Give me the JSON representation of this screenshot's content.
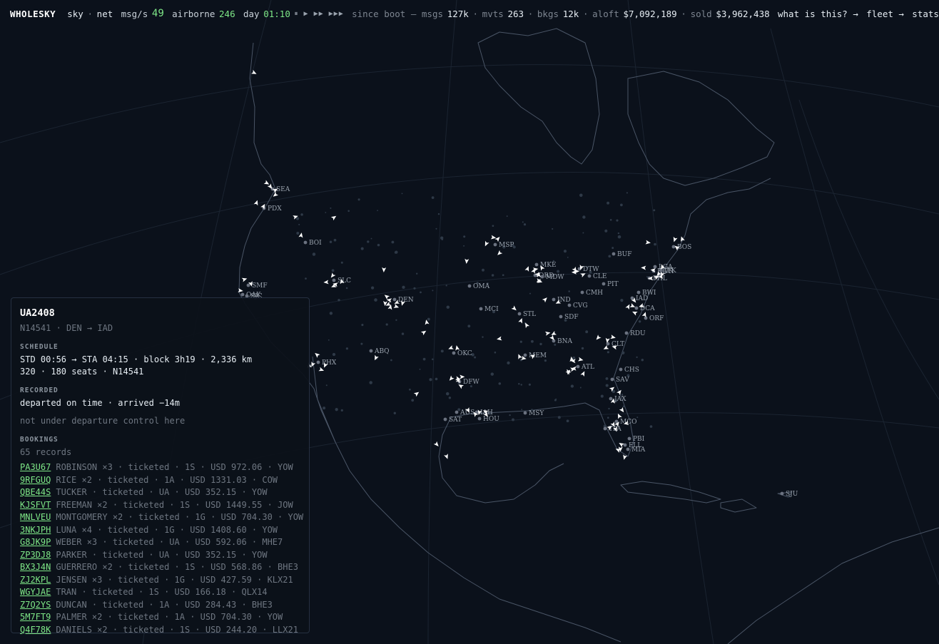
{
  "topbar": {
    "brand": "WHOLESKY",
    "nav_sky": "sky",
    "sep": "·",
    "nav_net": "net",
    "msgs_label": "msg/s",
    "msgs_value": "49",
    "airborne_label": "airborne",
    "airborne_value": "246",
    "day_label": "day",
    "day_value": "01:10",
    "playback_controls": "⏸ ▶ ▶▶ ▶▶▶",
    "since_boot_label": "since boot — msgs",
    "msgs_total": "127k",
    "mvts_label": "mvts",
    "mvts_value": "263",
    "bkgs_label": "bkgs",
    "bkgs_value": "12k",
    "aloft_label": "aloft",
    "aloft_value": "$7,092,189",
    "sold_label": "sold",
    "sold_value": "$3,962,438",
    "what_link": "what is this? →",
    "fleet_link": "fleet →",
    "stats_link": "stats"
  },
  "map": {
    "airports": [
      "SEA",
      "PDX",
      "BOI",
      "SMF",
      "SLC",
      "DEN",
      "PHX",
      "ABQ",
      "OKC",
      "DFW",
      "AUS",
      "SAT",
      "IAH",
      "HOU",
      "MSY",
      "MEM",
      "BNA",
      "ATL",
      "CLT",
      "RDU",
      "CHS",
      "SAV",
      "JAX",
      "MCO",
      "TPA",
      "PBI",
      "FLL",
      "MIA",
      "ORF",
      "DCA",
      "IAD",
      "BWI",
      "PHL",
      "EWR",
      "JFK",
      "LGA",
      "BOS",
      "BUF",
      "CLE",
      "DTW",
      "PIT",
      "CMH",
      "CVG",
      "IND",
      "STL",
      "SDF",
      "MCI",
      "OMA",
      "MSP",
      "MKE",
      "ORD",
      "MDW",
      "SJU",
      "OAK",
      "SJC"
    ]
  },
  "panel": {
    "flight": "UA2408",
    "route": "N14541 · DEN → IAD",
    "schedule_label": "SCHEDULE",
    "schedule_line1": "STD 00:56 → STA 04:15 · block 3h19 · 2,336 km",
    "schedule_line2": "320 · 180 seats · N14541",
    "recorded_label": "RECORDED",
    "recorded_line": "departed on time · arrived −14m",
    "control_note": "not under departure control here",
    "bookings_label": "BOOKINGS",
    "bookings_count": "65 records",
    "bookings": [
      {
        "pnr": "PA3U67",
        "detail": "ROBINSON ×3 · ticketed · 1S · USD 972.06 · YOW"
      },
      {
        "pnr": "9RFGUQ",
        "detail": "RICE ×2 · ticketed · 1A · USD 1331.03 · COW"
      },
      {
        "pnr": "QBE44S",
        "detail": "TUCKER · ticketed · UA · USD 352.15 · YOW"
      },
      {
        "pnr": "KJSFVT",
        "detail": "FREEMAN ×2 · ticketed · 1S · USD 1449.55 · JOW"
      },
      {
        "pnr": "MNLVEU",
        "detail": "MONTGOMERY ×2 · ticketed · 1G · USD 704.30 · YOW"
      },
      {
        "pnr": "3NKJPH",
        "detail": "LUNA ×4 · ticketed · 1G · USD 1408.60 · YOW"
      },
      {
        "pnr": "G8JK9P",
        "detail": "WEBER ×3 · ticketed · UA · USD 592.06 · MHE7"
      },
      {
        "pnr": "ZP3DJ8",
        "detail": "PARKER · ticketed · UA · USD 352.15 · YOW"
      },
      {
        "pnr": "BX3J4N",
        "detail": "GUERRERO ×2 · ticketed · 1S · USD 568.86 · BHE3"
      },
      {
        "pnr": "ZJ2KPL",
        "detail": "JENSEN ×3 · ticketed · 1G · USD 427.59 · KLX21"
      },
      {
        "pnr": "WGYJAE",
        "detail": "TRAN · ticketed · 1S · USD 166.18 · QLX14"
      },
      {
        "pnr": "Z7Q2YS",
        "detail": "DUNCAN · ticketed · 1A · USD 284.43 · BHE3"
      },
      {
        "pnr": "5M7FT9",
        "detail": "PALMER ×2 · ticketed · 1A · USD 704.30 · YOW"
      },
      {
        "pnr": "Q4F78K",
        "detail": "DANIELS ×2 · ticketed · 1S · USD 244.20 · LLX21"
      }
    ]
  }
}
